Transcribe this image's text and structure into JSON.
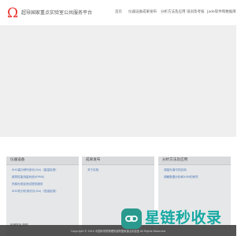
{
  "header": {
    "title": "超导国家重点实验室公共服务平台",
    "logo_glyph": "Ω",
    "logo_color": "#e8322c",
    "nav": [
      "首页",
      "仪器设备",
      "成果发布",
      "分析方法及应用",
      "培训及考核",
      "Jade软件和数据库"
    ]
  },
  "panels": [
    {
      "title": "仪器设备",
      "links": [
        "SHG高分辨衍射仪(Gd)（高温检测）",
        "超导性能测量系统(KPMS)",
        "热释光测定测试提供服务",
        "SHG热分析测试仪(Gd)（低温检测）"
      ]
    },
    {
      "title": "成果发布",
      "links": [
        "关于实验"
      ]
    },
    {
      "title": "分析方法及应用",
      "links": [
        "调量光谱中的应用",
        "调解数据分析和XSM的研究"
      ]
    }
  ],
  "lower_panel": {
    "title": "检测样品 制样"
  },
  "footer": {
    "copyright": "Copyright © 2015 中国科学院物理所超导国家重点实验室 All Rights Reserved"
  },
  "watermark": {
    "text": "星链秒收录",
    "icon_color": "#2b9a8e",
    "text_color": "#16a7a1"
  }
}
